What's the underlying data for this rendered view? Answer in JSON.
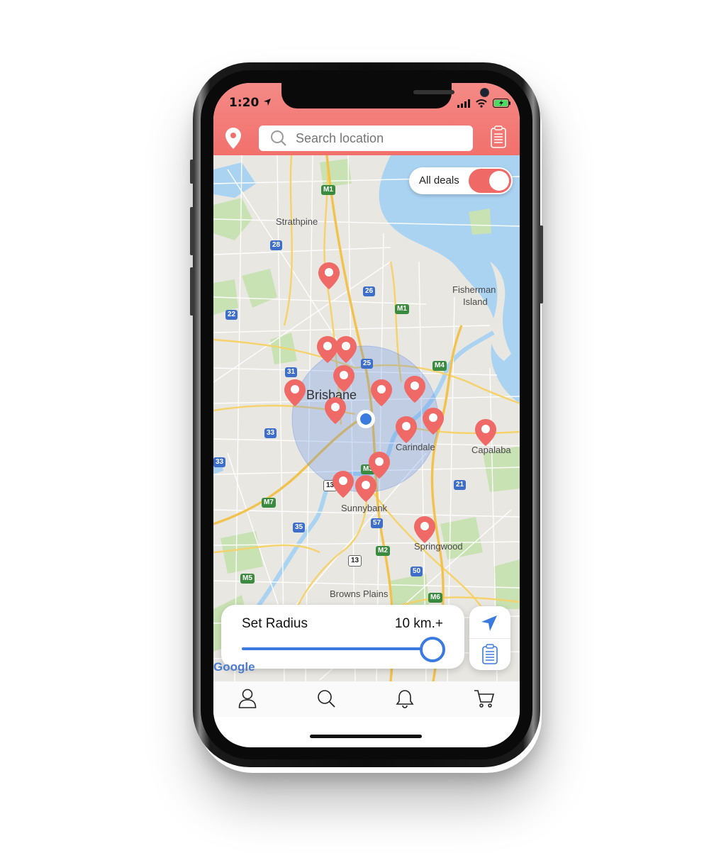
{
  "status_bar": {
    "time": "1:20"
  },
  "header": {
    "location_icon": "map-pin-icon",
    "search_placeholder": "Search location",
    "list_icon": "clipboard-icon"
  },
  "map": {
    "toggle": {
      "label": "All deals",
      "on": true
    },
    "labels": {
      "strathpine": "Strathpine",
      "fisherman": "Fisherman",
      "island": "Island",
      "brisbane": "Brisbane",
      "carindale": "Carindale",
      "capalaba": "Capalaba",
      "sunnybank": "Sunnybank",
      "springwood": "Springwood",
      "browns_plains": "Browns Plains"
    },
    "shields": {
      "m1a": "M1",
      "s28": "28",
      "s26": "26",
      "m1b": "M1",
      "s22": "22",
      "s25": "25",
      "m4": "M4",
      "s31": "31",
      "s33a": "33",
      "s33b": "33",
      "m3": "M3",
      "s13a": "13",
      "s21": "21",
      "m7": "M7",
      "s35": "35",
      "s57": "57",
      "m2": "M2",
      "s13b": "13",
      "s50": "50",
      "m5": "M5",
      "m6": "M6"
    },
    "google_logo": "Google",
    "accent_color": "#ef6a66",
    "radius_circle_color": "#5b8de6"
  },
  "radius_card": {
    "label": "Set Radius",
    "value": "10 km.+",
    "slider_fraction": 1.0
  },
  "side_card": {
    "navigate_icon": "navigation-arrow-icon",
    "list_icon": "clipboard-icon"
  },
  "tab_bar": {
    "items": [
      "profile-icon",
      "search-icon",
      "bell-icon",
      "cart-icon"
    ]
  }
}
